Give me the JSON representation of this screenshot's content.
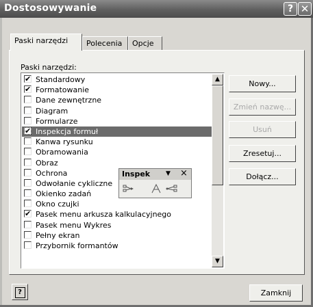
{
  "window": {
    "title": "Dostosowywanie"
  },
  "tabs": [
    {
      "label": "Paski narzędzi",
      "active": true
    },
    {
      "label": "Polecenia",
      "active": false
    },
    {
      "label": "Opcje",
      "active": false
    }
  ],
  "list_label": "Paski narzędzi:",
  "toolbars": [
    {
      "label": "Standardowy",
      "checked": true,
      "selected": false
    },
    {
      "label": "Formatowanie",
      "checked": true,
      "selected": false
    },
    {
      "label": "Dane zewnętrzne",
      "checked": false,
      "selected": false
    },
    {
      "label": "Diagram",
      "checked": false,
      "selected": false
    },
    {
      "label": "Formularze",
      "checked": false,
      "selected": false
    },
    {
      "label": "Inspekcja formuł",
      "checked": true,
      "selected": true
    },
    {
      "label": "Kanwa rysunku",
      "checked": false,
      "selected": false
    },
    {
      "label": "Obramowania",
      "checked": false,
      "selected": false
    },
    {
      "label": "Obraz",
      "checked": false,
      "selected": false
    },
    {
      "label": "Ochrona",
      "checked": false,
      "selected": false
    },
    {
      "label": "Odwołanie cykliczne",
      "checked": false,
      "selected": false
    },
    {
      "label": "Okienko zadań",
      "checked": false,
      "selected": false
    },
    {
      "label": "Okno czujki",
      "checked": false,
      "selected": false
    },
    {
      "label": "Pasek menu arkusza kalkulacyjnego",
      "checked": true,
      "selected": false
    },
    {
      "label": "Pasek menu Wykres",
      "checked": false,
      "selected": false
    },
    {
      "label": "Pełny ekran",
      "checked": false,
      "selected": false
    },
    {
      "label": "Przybornik formantów",
      "checked": false,
      "selected": false
    }
  ],
  "buttons": {
    "new": "Nowy...",
    "rename": "Zmień nazwę...",
    "delete": "Usuń",
    "reset": "Zresetuj...",
    "attach": "Dołącz..."
  },
  "floating_toolbar": {
    "title": "Inspek",
    "dropdown": "▼",
    "close": "×"
  },
  "close_button": "Zamknij",
  "icons": {
    "help": "help-question-icon",
    "close": "close-x-icon"
  }
}
